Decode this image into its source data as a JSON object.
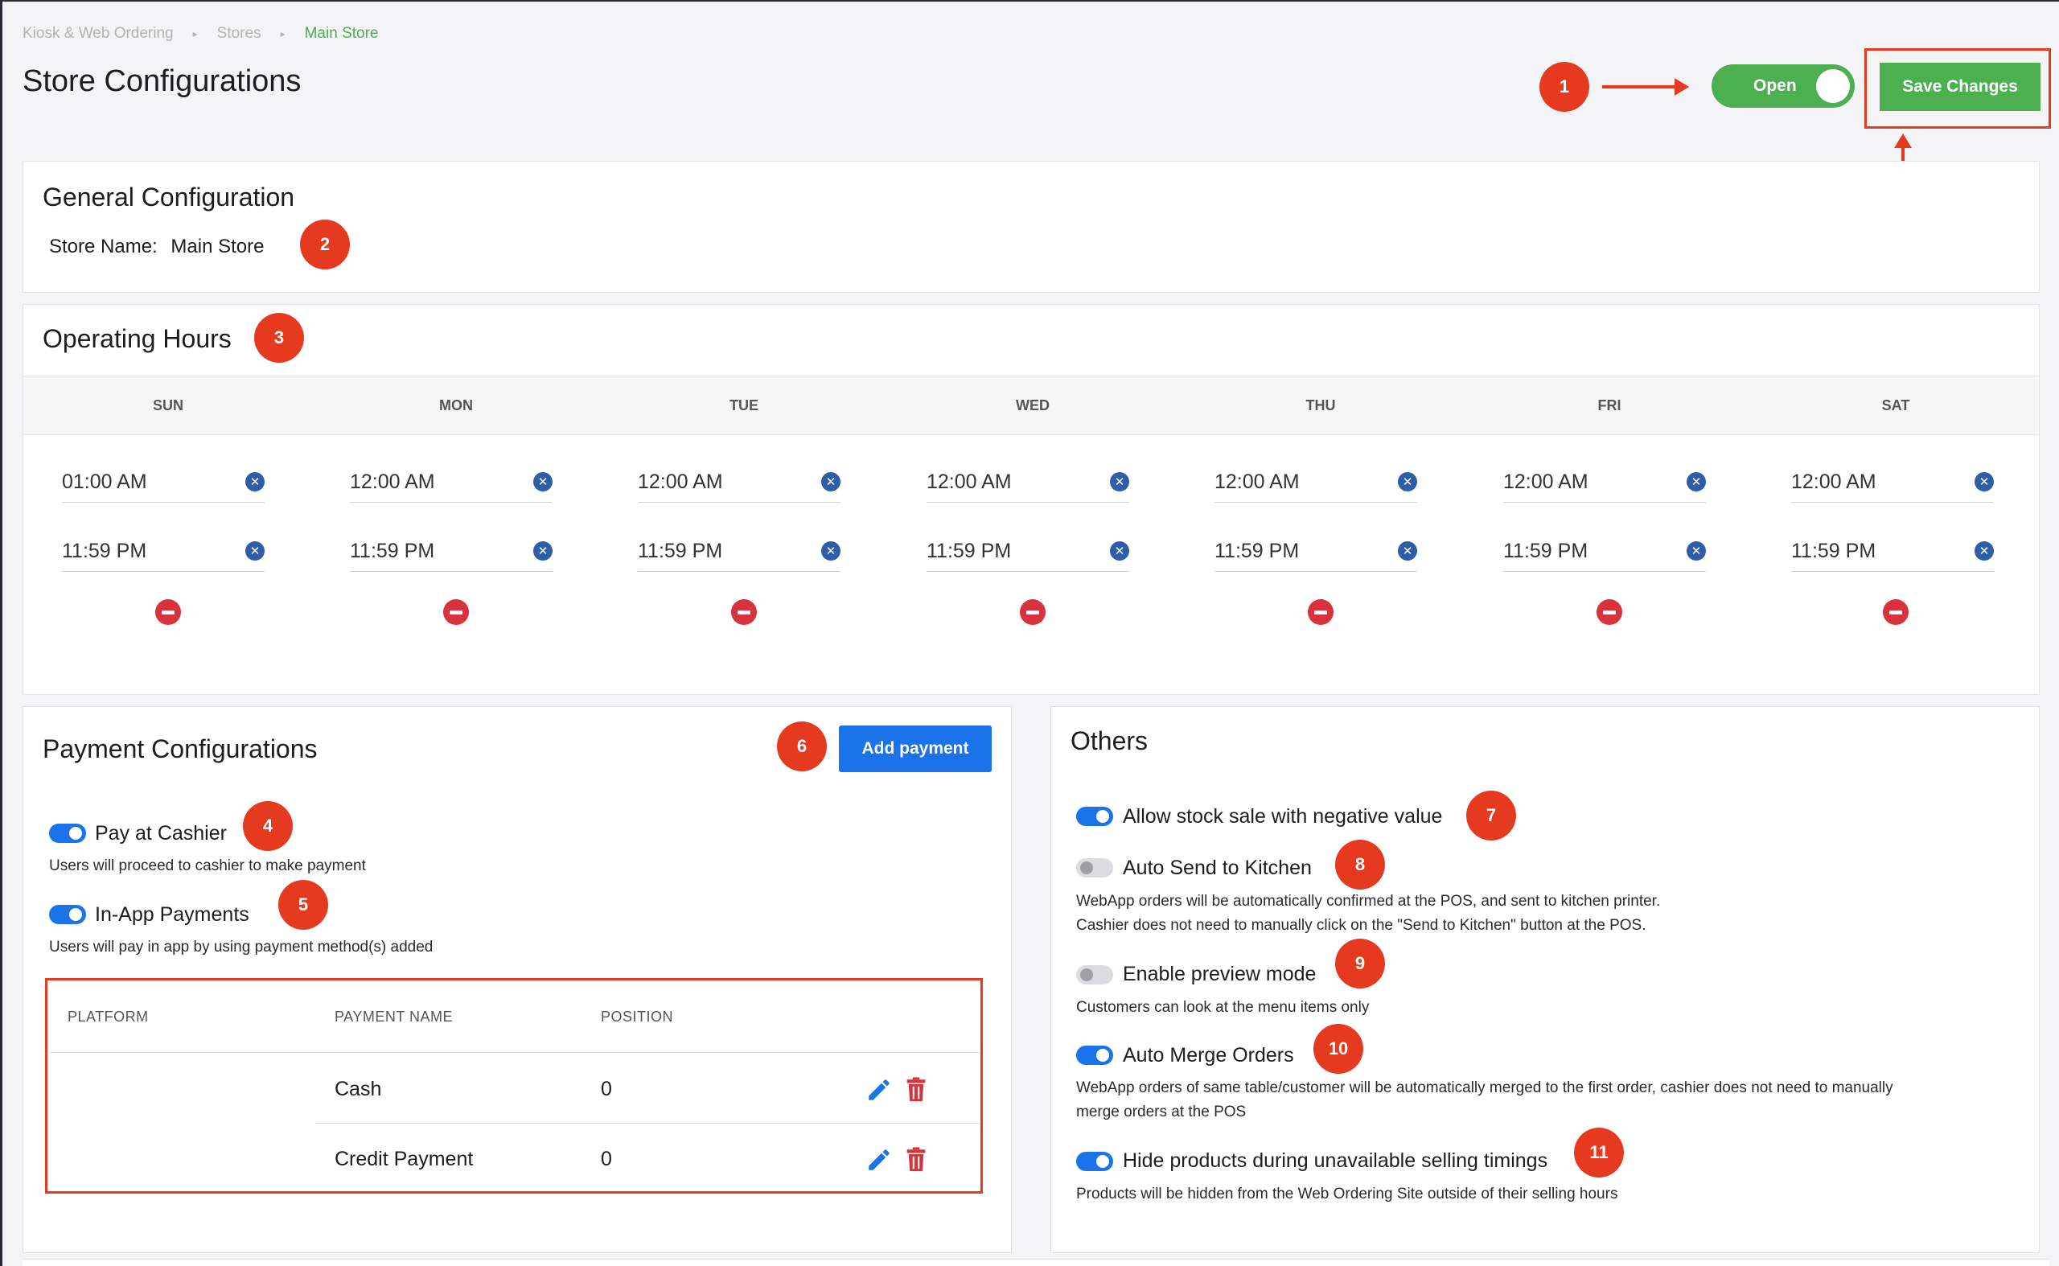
{
  "breadcrumb": {
    "root": "Kiosk & Web Ordering",
    "stores": "Stores",
    "current": "Main Store"
  },
  "page_title": "Store Configurations",
  "header": {
    "open_label": "Open",
    "save_label": "Save Changes"
  },
  "callouts": [
    "1",
    "2",
    "3",
    "4",
    "5",
    "6",
    "7",
    "8",
    "9",
    "10",
    "11"
  ],
  "general": {
    "title": "General Configuration",
    "store_name_label": "Store Name:",
    "store_name_value": "Main Store"
  },
  "hours": {
    "title": "Operating Hours",
    "days": [
      {
        "day": "SUN",
        "open": "01:00 AM",
        "close": "11:59 PM"
      },
      {
        "day": "MON",
        "open": "12:00 AM",
        "close": "11:59 PM"
      },
      {
        "day": "TUE",
        "open": "12:00 AM",
        "close": "11:59 PM"
      },
      {
        "day": "WED",
        "open": "12:00 AM",
        "close": "11:59 PM"
      },
      {
        "day": "THU",
        "open": "12:00 AM",
        "close": "11:59 PM"
      },
      {
        "day": "FRI",
        "open": "12:00 AM",
        "close": "11:59 PM"
      },
      {
        "day": "SAT",
        "open": "12:00 AM",
        "close": "11:59 PM"
      }
    ]
  },
  "payment": {
    "title": "Payment Configurations",
    "add_label": "Add payment",
    "pay_at_cashier": {
      "label": "Pay at Cashier",
      "desc": "Users will proceed to cashier to make payment",
      "on": true
    },
    "in_app": {
      "label": "In-App Payments",
      "desc": "Users will pay in app by using payment method(s) added",
      "on": true
    },
    "table": {
      "headers": [
        "PLATFORM",
        "PAYMENT NAME",
        "POSITION"
      ],
      "rows": [
        {
          "platform": "",
          "name": "Cash",
          "position": "0"
        },
        {
          "platform": "",
          "name": "Credit Payment",
          "position": "0"
        }
      ]
    }
  },
  "others": {
    "title": "Others",
    "items": [
      {
        "label": "Allow stock sale with negative value",
        "on": true,
        "desc": ""
      },
      {
        "label": "Auto Send to Kitchen",
        "on": false,
        "desc1": "WebApp orders will be automatically confirmed at the POS, and sent to kitchen printer.",
        "desc2": "Cashier does not need to manually click on the \"Send to Kitchen\" button at the POS."
      },
      {
        "label": "Enable preview mode",
        "on": false,
        "desc1": "Customers can look at the menu items only"
      },
      {
        "label": "Auto Merge Orders",
        "on": true,
        "desc1": "WebApp orders of same table/customer will be automatically merged to the first order, cashier does not need to manually",
        "desc2": "merge orders at the POS"
      },
      {
        "label": "Hide products during unavailable selling timings",
        "on": true,
        "desc1": "Products will be hidden from the Web Ordering Site outside of their selling hours"
      }
    ]
  },
  "colors": {
    "accent_green": "#4caf50",
    "accent_blue": "#1a73e8",
    "callout_red": "#e53a20",
    "danger_red": "#d8323c"
  },
  "icons": [
    "x-circle-icon",
    "minus-circle-icon",
    "pencil-icon",
    "trash-icon",
    "chevron-right-icon"
  ]
}
